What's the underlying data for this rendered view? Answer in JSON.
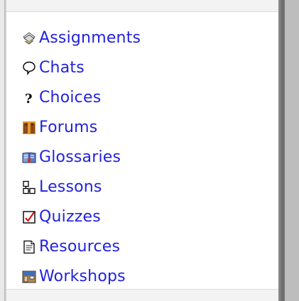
{
  "activities": {
    "items": [
      {
        "label": "Assignments",
        "icon": "assignment-icon"
      },
      {
        "label": "Chats",
        "icon": "chat-icon"
      },
      {
        "label": "Choices",
        "icon": "choice-icon"
      },
      {
        "label": "Forums",
        "icon": "forum-icon"
      },
      {
        "label": "Glossaries",
        "icon": "glossary-icon"
      },
      {
        "label": "Lessons",
        "icon": "lesson-icon"
      },
      {
        "label": "Quizzes",
        "icon": "quiz-icon"
      },
      {
        "label": "Resources",
        "icon": "resource-icon"
      },
      {
        "label": "Workshops",
        "icon": "workshop-icon"
      }
    ]
  },
  "colors": {
    "link": "#2222dd",
    "block_background": "#ffffff",
    "frame_gray": "#c8c8c8"
  }
}
